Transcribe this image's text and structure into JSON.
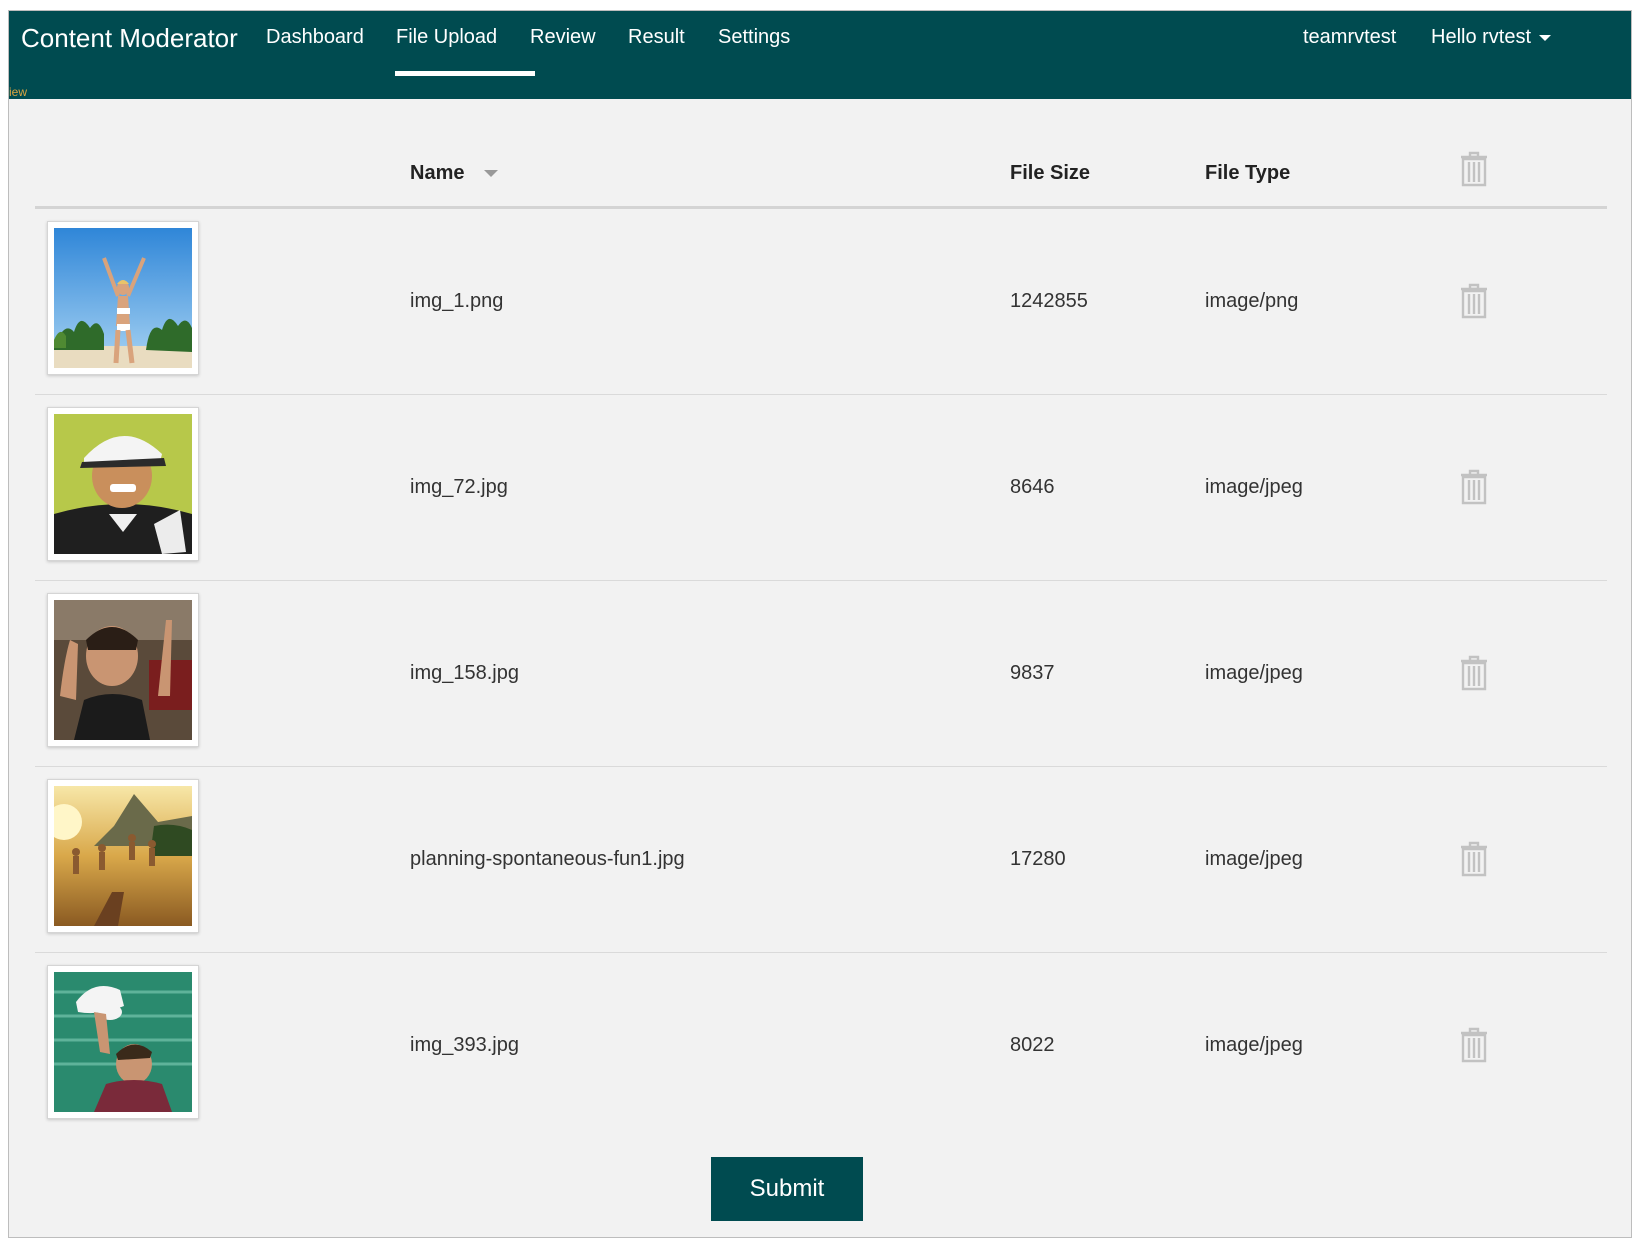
{
  "nav": {
    "brand": "Content Moderator",
    "items": [
      {
        "label": "Dashboard",
        "active": false
      },
      {
        "label": "File Upload",
        "active": true
      },
      {
        "label": "Review",
        "active": false
      },
      {
        "label": "Result",
        "active": false
      },
      {
        "label": "Settings",
        "active": false
      }
    ],
    "team": "teamrvtest",
    "user_greeting": "Hello rvtest",
    "stray_text": "iew"
  },
  "table": {
    "headers": {
      "name": "Name",
      "file_size": "File Size",
      "file_type": "File Type"
    },
    "rows": [
      {
        "name": "img_1.png",
        "size": "1242855",
        "type": "image/png"
      },
      {
        "name": "img_72.jpg",
        "size": "8646",
        "type": "image/jpeg"
      },
      {
        "name": "img_158.jpg",
        "size": "9837",
        "type": "image/jpeg"
      },
      {
        "name": "planning-spontaneous-fun1.jpg",
        "size": "17280",
        "type": "image/jpeg"
      },
      {
        "name": "img_393.jpg",
        "size": "8022",
        "type": "image/jpeg"
      }
    ]
  },
  "submit_label": "Submit",
  "colors": {
    "brand": "#004b50",
    "background": "#f2f2f2",
    "trash_icon": "#c2c2c2"
  },
  "icons": [
    "trash-icon",
    "sort-desc-icon",
    "caret-down-icon"
  ]
}
